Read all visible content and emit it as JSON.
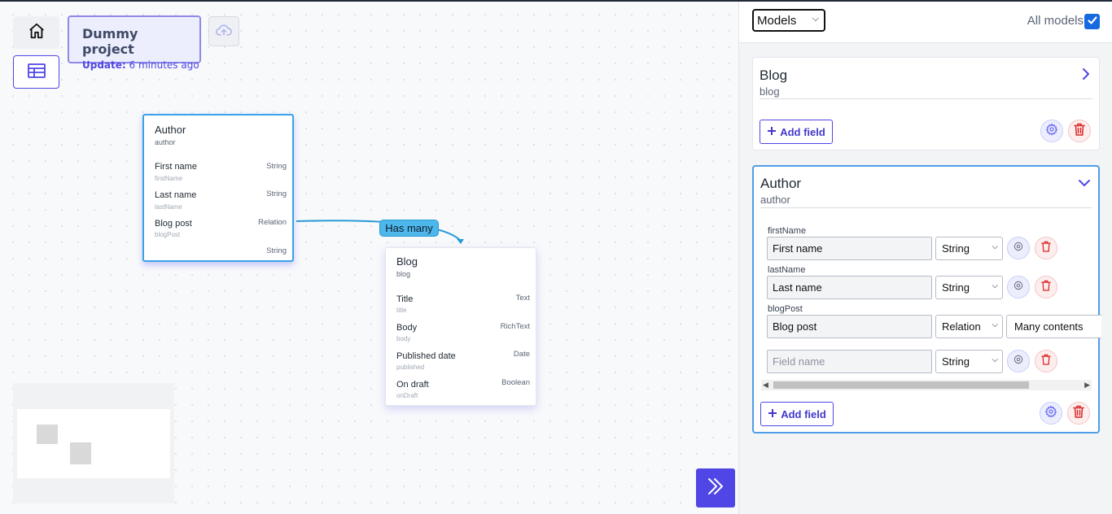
{
  "project": {
    "name": "Dummy project",
    "update_label": "Update:",
    "update_value": "6 minutes ago"
  },
  "canvas": {
    "edge_label": "Has many",
    "nodes": {
      "author": {
        "title": "Author",
        "subtitle": "author",
        "fields": [
          {
            "name": "First name",
            "key": "firstName",
            "type": "String"
          },
          {
            "name": "Last name",
            "key": "lastName",
            "type": "String"
          },
          {
            "name": "Blog post",
            "key": "blogPost",
            "type": "Relation"
          },
          {
            "name": "",
            "key": "",
            "type": "String"
          }
        ]
      },
      "blog": {
        "title": "Blog",
        "subtitle": "blog",
        "fields": [
          {
            "name": "Title",
            "key": "title",
            "type": "Text"
          },
          {
            "name": "Body",
            "key": "body",
            "type": "RichText"
          },
          {
            "name": "Published date",
            "key": "published",
            "type": "Date"
          },
          {
            "name": "On draft",
            "key": "onDraft",
            "type": "Boolean"
          }
        ]
      }
    }
  },
  "panel": {
    "view_select": "Models",
    "all_models_label": "All models",
    "all_models_checked": true,
    "add_field_label": "Add field",
    "cards": {
      "blog": {
        "title": "Blog",
        "subtitle": "blog",
        "expanded": false
      },
      "author": {
        "title": "Author",
        "subtitle": "author",
        "expanded": true,
        "fields": [
          {
            "key": "firstName",
            "name": "First name",
            "type": "String"
          },
          {
            "key": "lastName",
            "name": "Last name",
            "type": "String"
          },
          {
            "key": "blogPost",
            "name": "Blog post",
            "type": "Relation",
            "relation": "Many contents"
          }
        ],
        "new_field": {
          "placeholder": "Field name",
          "type": "String"
        }
      }
    }
  },
  "colors": {
    "accent": "#4f46e5",
    "edge": "#2b9ad6",
    "danger": "#dc2626"
  },
  "icons": [
    "home-icon",
    "table-icon",
    "cloud-upload-icon",
    "chevron-right-icon",
    "chevron-down-icon",
    "plus-icon",
    "gear-icon",
    "trash-icon",
    "double-chevron-right-icon",
    "check-icon"
  ]
}
